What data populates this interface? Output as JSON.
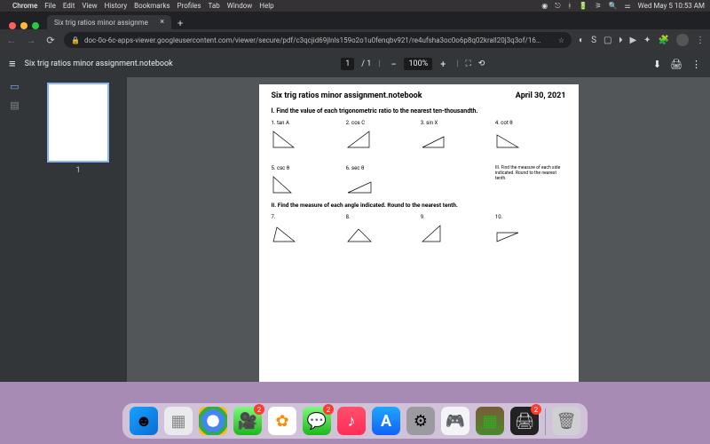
{
  "mac_menu": {
    "app": "Chrome",
    "items": [
      "File",
      "Edit",
      "View",
      "History",
      "Bookmarks",
      "Profiles",
      "Tab",
      "Window",
      "Help"
    ],
    "status_icons": [
      "record",
      "airdrop",
      "bluetooth",
      "battery",
      "wifi",
      "search",
      "control-center"
    ],
    "clock": "Wed May 5 10:53 AM"
  },
  "browser": {
    "tab_title": "Six trig ratios minor assignme",
    "url": "doc-0o-6c-apps-viewer.googleusercontent.com/viewer/secure/pdf/c3qcjid69jlnls159o2o1u0fenqbv921/re4ufsha3oc0o6p8q02krall20j3q3of/16…",
    "star": "☆",
    "ext_icons": [
      "◐",
      "S",
      "▢",
      "🞂",
      "▶",
      "✦",
      "🧩",
      "⋮"
    ]
  },
  "pdf": {
    "filename": "Six trig ratios minor assignment.notebook",
    "page_current": "1",
    "page_total": "1",
    "zoom": "100%",
    "thumb_label": "1",
    "doc": {
      "title": "Six trig ratios minor assignment.notebook",
      "date": "April 30, 2021",
      "section1": "I.  Find the value of each trigonometric ratio to the nearest ten-thousandth.",
      "q1": "1. tan A",
      "q2": "2. cos C",
      "q3": "3. sin X",
      "q4": "4. cot θ",
      "q5": "5. csc θ",
      "q6": "6. sec θ",
      "section3": "III. Find the measure of each side indicated. Round to the nearest tenth.",
      "section2": "II. Find the measure of each angle indicated.  Round to the nearest tenth.",
      "q7": "7.",
      "q8": "8.",
      "q9": "9.",
      "q10": "10."
    }
  },
  "dock": {
    "apps": [
      {
        "name": "finder",
        "glyph": "☻"
      },
      {
        "name": "launchpad",
        "glyph": "▦"
      },
      {
        "name": "chrome",
        "glyph": ""
      },
      {
        "name": "facetime",
        "glyph": "🎥",
        "badge": "2"
      },
      {
        "name": "photos",
        "glyph": "✿"
      },
      {
        "name": "messages",
        "glyph": "💬",
        "badge": "2"
      },
      {
        "name": "music",
        "glyph": "♪"
      },
      {
        "name": "appstore",
        "glyph": "A"
      },
      {
        "name": "settings",
        "glyph": "⚙"
      },
      {
        "name": "discord",
        "glyph": "🎮"
      },
      {
        "name": "minecraft",
        "glyph": "▦"
      },
      {
        "name": "printer",
        "glyph": "🖨",
        "badge": "2"
      }
    ],
    "trash": {
      "glyph": "🗑"
    }
  }
}
